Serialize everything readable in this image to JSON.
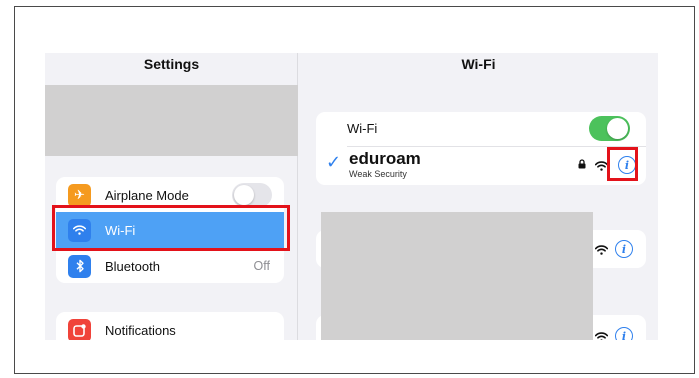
{
  "sidebar": {
    "title": "Settings",
    "items": [
      {
        "label": "Airplane Mode",
        "icon": "airplane-icon",
        "icon_color": "#f59a1f",
        "toggle": "off"
      },
      {
        "label": "Wi-Fi",
        "icon": "wifi-icon",
        "icon_color": "#2f80ed",
        "selected": true
      },
      {
        "label": "Bluetooth",
        "value": "Off",
        "icon": "bluetooth-icon",
        "icon_color": "#2f80ed"
      },
      {
        "label": "Notifications",
        "icon": "notifications-icon",
        "icon_color": "#f0433a"
      }
    ]
  },
  "detail": {
    "title": "Wi-Fi",
    "wifi_label": "Wi-Fi",
    "wifi_toggle": "on",
    "connected_network": {
      "name": "eduroam",
      "subtitle": "Weak Security",
      "icons": [
        "checkmark-icon",
        "lock-icon",
        "wifi-signal-icon",
        "info-icon"
      ]
    },
    "info_glyph": "i"
  },
  "colors": {
    "accent": "#2f80ed",
    "toggle_on": "#4cc25c",
    "selection": "#4ea1f5",
    "highlight": "#e3121a",
    "redacted": "#d1d0d0"
  }
}
